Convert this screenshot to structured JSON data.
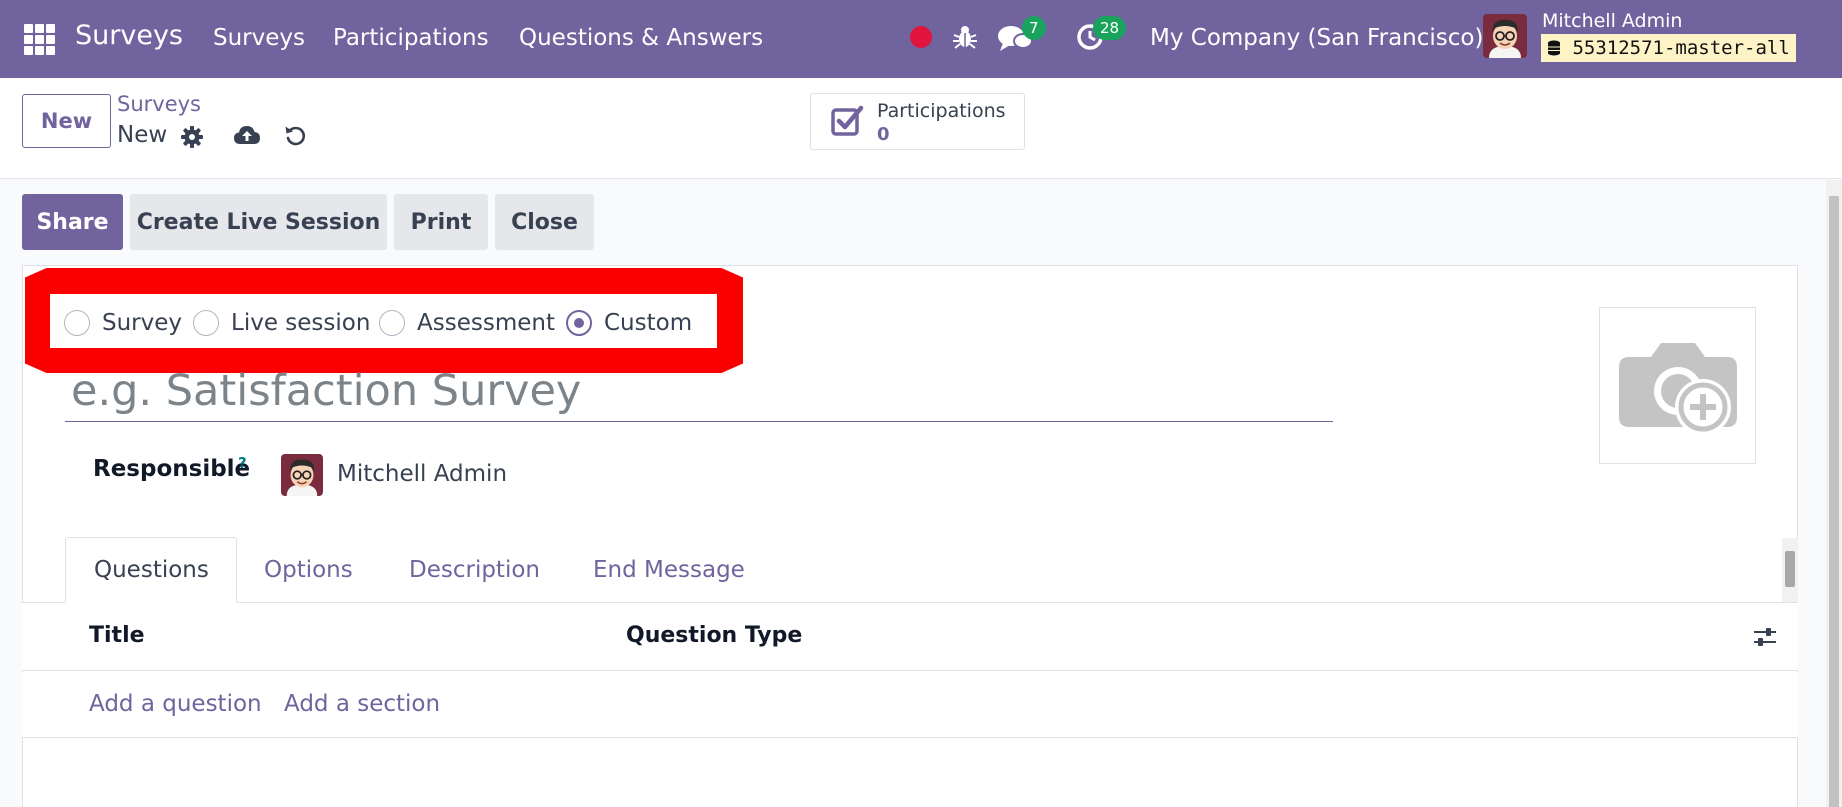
{
  "navbar": {
    "app_name": "Surveys",
    "menu": [
      "Surveys",
      "Participations",
      "Questions & Answers"
    ],
    "chat_count": "7",
    "activity_count": "28",
    "company": "My Company (San Francisco)",
    "user": "Mitchell Admin",
    "database": "55312571-master-all",
    "colors": {
      "navbar": "#71639e",
      "badge": "#19a35c",
      "record": "#e0143c"
    }
  },
  "control_panel": {
    "new_label": "New",
    "breadcrumb_parent": "Surveys",
    "breadcrumb_current": "New",
    "stat_label": "Participations",
    "stat_value": "0"
  },
  "actions": {
    "share": "Share",
    "live_session": "Create Live Session",
    "print": "Print",
    "close": "Close"
  },
  "form": {
    "survey_types": [
      {
        "label": "Survey",
        "checked": false
      },
      {
        "label": "Live session",
        "checked": false
      },
      {
        "label": "Assessment",
        "checked": false
      },
      {
        "label": "Custom",
        "checked": true
      }
    ],
    "title_placeholder": "e.g. Satisfaction Survey",
    "responsible_label": "Responsible",
    "help_mark": "?",
    "responsible_value": "Mitchell Admin",
    "highlight_color": "#fb0000"
  },
  "tabs": [
    "Questions",
    "Options",
    "Description",
    "End Message"
  ],
  "list": {
    "col_title": "Title",
    "col_type": "Question Type",
    "add_question": "Add a question",
    "add_section": "Add a section"
  }
}
